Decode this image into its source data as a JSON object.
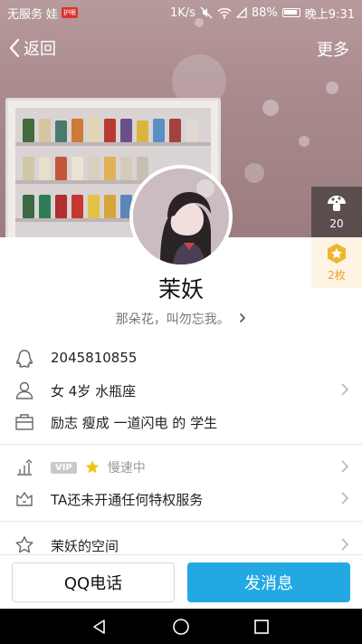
{
  "status_bar": {
    "carrier": "无服务",
    "carrier_suffix": "娃",
    "badge": "护眼",
    "net_speed": "1K/s",
    "battery": "88%",
    "time": "晚上9:31"
  },
  "nav": {
    "back_label": "返回",
    "more_label": "更多"
  },
  "side": {
    "likes_count": "20",
    "medals_label": "2枚"
  },
  "profile": {
    "name": "茉妖",
    "signature": "那朵花，叫勿忘我。",
    "qq_number": "2045810855",
    "basic_info": "女  4岁  水瓶座",
    "tags": "励志 瘦成 一道闪电 的 学生",
    "vip_badge": "VIP",
    "vip_status": "慢速中",
    "privilege_text": "TA还未开通任何特权服务",
    "space_label": "茉妖的空间"
  },
  "actions": {
    "call_label": "QQ电话",
    "message_label": "发消息"
  },
  "colors": {
    "accent": "#23a8e4",
    "medal": "#e3a424"
  }
}
